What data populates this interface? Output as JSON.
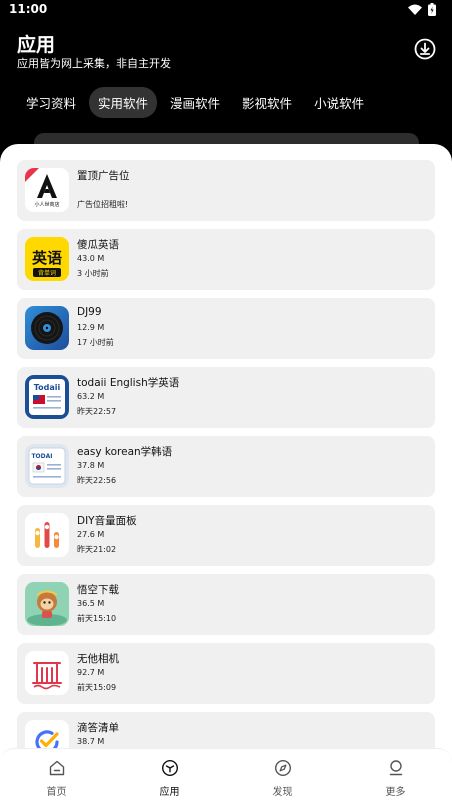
{
  "status": {
    "time": "11:00"
  },
  "header": {
    "title": "应用",
    "subtitle": "应用皆为网上采集，非自主开发"
  },
  "tabs": [
    {
      "label": "学习资料",
      "active": false
    },
    {
      "label": "实用软件",
      "active": true
    },
    {
      "label": "漫画软件",
      "active": false
    },
    {
      "label": "影视软件",
      "active": false
    },
    {
      "label": "小说软件",
      "active": false
    }
  ],
  "ad": {
    "name": "置顶广告位",
    "desc": "广告位招租啦!",
    "logo_text": "小人世商店"
  },
  "apps": [
    {
      "name": "傻瓜英语",
      "size": "43.0 M",
      "time": "3 小时前",
      "icon": "shagua-english-icon",
      "icon_text": "英语",
      "icon_sub": "背单词"
    },
    {
      "name": "DJ99",
      "size": "12.9 M",
      "time": "17 小时前",
      "icon": "dj99-vinyl-icon"
    },
    {
      "name": "todaii English学英语",
      "size": "63.2 M",
      "time": "昨天22:57",
      "icon": "todaii-english-icon",
      "icon_text": "Todaii"
    },
    {
      "name": "easy korean学韩语",
      "size": "37.8 M",
      "time": "昨天22:56",
      "icon": "todai-korean-icon",
      "icon_text": "TODAI"
    },
    {
      "name": "DIY音量面板",
      "size": "27.6 M",
      "time": "昨天21:02",
      "icon": "volume-panel-icon"
    },
    {
      "name": "悟空下载",
      "size": "36.5 M",
      "time": "前天15:10",
      "icon": "wukong-download-icon"
    },
    {
      "name": "无他相机",
      "size": "92.7 M",
      "time": "前天15:09",
      "icon": "wuta-camera-icon"
    },
    {
      "name": "滴答清单",
      "size": "38.7 M",
      "time": "",
      "icon": "ticktick-icon"
    }
  ],
  "nav": [
    {
      "label": "首页",
      "icon": "home-icon",
      "active": false
    },
    {
      "label": "应用",
      "icon": "cube-icon",
      "active": true
    },
    {
      "label": "发现",
      "icon": "compass-icon",
      "active": false
    },
    {
      "label": "更多",
      "icon": "person-icon",
      "active": false
    }
  ],
  "colors": {
    "background": "#000000",
    "sheet": "#ffffff",
    "card": "#f0f0f0",
    "active_tab": "#333333"
  }
}
